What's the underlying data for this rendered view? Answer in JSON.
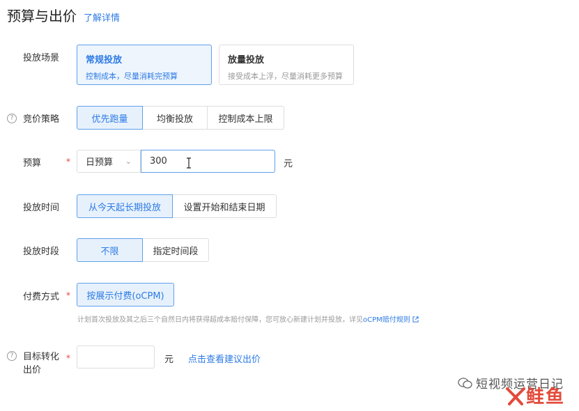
{
  "header": {
    "title": "预算与出价",
    "details_link": "了解详情"
  },
  "scene": {
    "label": "投放场景",
    "cards": [
      {
        "title": "常规投放",
        "desc": "控制成本，尽量消耗完预算",
        "active": true
      },
      {
        "title": "放量投放",
        "desc": "接受成本上浮，尽量消耗更多预算",
        "active": false
      }
    ]
  },
  "bid_strategy": {
    "label": "竞价策略",
    "help": "?",
    "options": [
      "优先跑量",
      "均衡投放",
      "控制成本上限"
    ],
    "selected": "优先跑量"
  },
  "budget": {
    "label": "预算",
    "required_mark": "*",
    "type_value": "日预算",
    "amount": "300",
    "unit": "元"
  },
  "schedule_time": {
    "label": "投放时间",
    "options": [
      "从今天起长期投放",
      "设置开始和结束日期"
    ],
    "selected": "从今天起长期投放"
  },
  "schedule_period": {
    "label": "投放时段",
    "options": [
      "不限",
      "指定时间段"
    ],
    "selected": "不限"
  },
  "payment": {
    "label": "付费方式",
    "required_mark": "*",
    "option": "按展示付费(oCPM)",
    "hint": "计划首次投放及其之后三个自然日内将获得超成本赔付保障，您可放心新建计划并投放，详见",
    "hint_link": "oCPM赔付规则"
  },
  "target": {
    "label_line1": "目标转化",
    "label_line2": "出价",
    "help": "?",
    "required_mark": "*",
    "unit": "元",
    "suggest_link": "点击查看建议出价"
  },
  "watermark": {
    "text": "短视频运营日记",
    "logo": "鲑鱼"
  },
  "colors": {
    "accent": "#2d7be5",
    "active_bg": "#e7f1fc",
    "required": "#e8463b"
  }
}
